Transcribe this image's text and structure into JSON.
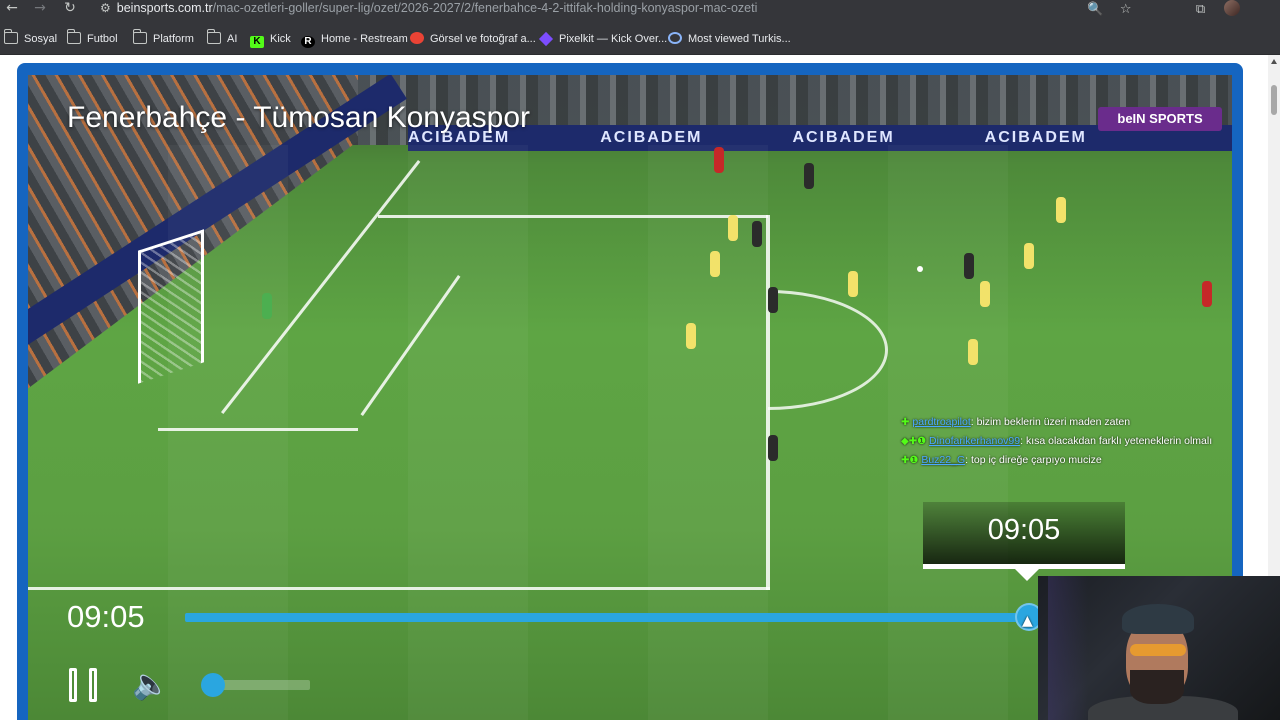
{
  "browser": {
    "url_domain": "beinsports.com.tr",
    "url_path": "/mac-ozetleri-goller/super-lig/ozet/2026-2027/2/fenerbahce-4-2-ittifak-holding-konyaspor-mac-ozeti",
    "back_icon": "←",
    "forward_icon": "→",
    "reload_icon": "↻",
    "site_info_icon": "⚙",
    "zoom_icon": "🔍",
    "star_icon": "☆",
    "extensions_icon": "⧉",
    "tab_search_icon": "≡"
  },
  "bookmarks": [
    {
      "label": "Sosyal",
      "icon": "folder-icon"
    },
    {
      "label": "Futbol",
      "icon": "folder-icon"
    },
    {
      "label": "Platform",
      "icon": "folder-icon"
    },
    {
      "label": "AI",
      "icon": "folder-icon"
    },
    {
      "label": "Kick",
      "icon": "kick-icon",
      "glyph": "K"
    },
    {
      "label": "Home - Restream",
      "icon": "restream-icon",
      "glyph": "R"
    },
    {
      "label": "Görsel ve fotoğraf a...",
      "icon": "image-icon"
    },
    {
      "label": "Pixelkit — Kick Over...",
      "icon": "pixelkit-icon"
    },
    {
      "label": "Most viewed Turkis...",
      "icon": "stats-icon"
    }
  ],
  "video": {
    "title": "Fenerbahçe - Tümosan Konyaspor",
    "broadcaster_logo": "beIN SPORTS",
    "ad_text": "ACIBADEM",
    "current_time": "09:05",
    "hover_time": "09:05",
    "progress_fraction": 0.98,
    "volume_fraction": 0.0,
    "watermark": "bein",
    "accent_color": "#2aa6e0"
  },
  "chat": [
    {
      "user": "pardtroapilot",
      "message": ": bizim beklerin üzeri maden zaten",
      "badges": "✚"
    },
    {
      "user": "Dinofarikerhanov99",
      "message": ": kısa olacakdan farklı yeteneklerin olmalı",
      "badges": "◆✚❶"
    },
    {
      "user": "Buz22_G",
      "message": ": top iç direğe çarpıyo mucize",
      "badges": "✚❶"
    }
  ],
  "controls": {
    "pause_icon": "pause-icon",
    "volume_icon": "🔈"
  }
}
